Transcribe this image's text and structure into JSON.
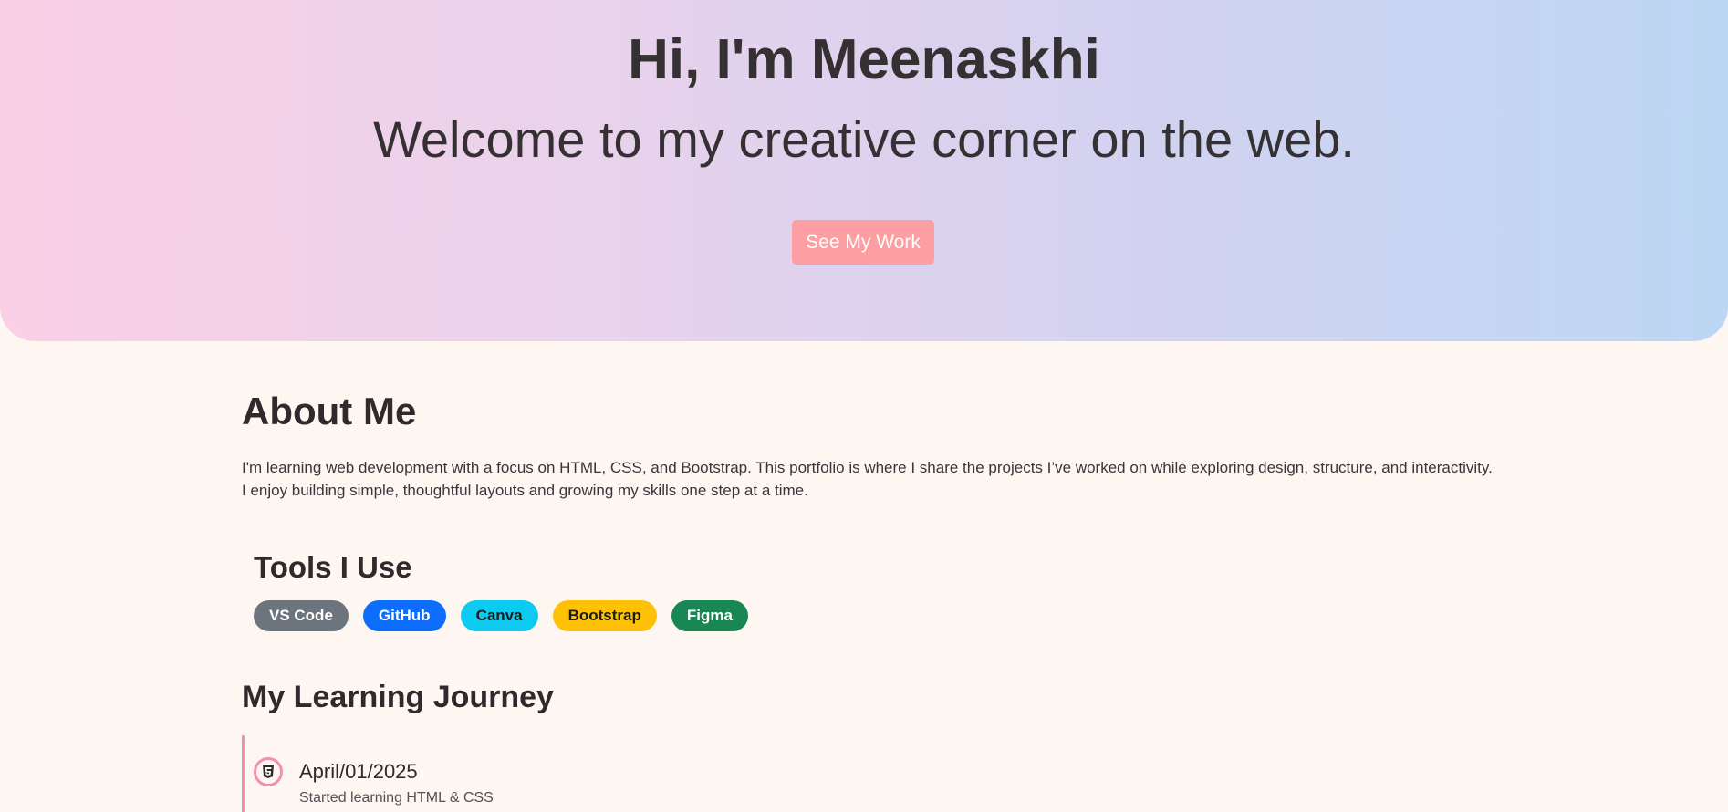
{
  "hero": {
    "title": "Hi, I'm Meenaskhi",
    "subtitle": "Welcome to my creative corner on the web.",
    "button_label": "See My Work"
  },
  "about": {
    "title": "About Me",
    "text": "I'm learning web development with a focus on HTML, CSS, and Bootstrap. This portfolio is where I share the projects I’ve worked on while exploring design, structure, and interactivity. I enjoy building simple, thoughtful layouts and growing my skills one step at a time."
  },
  "tools": {
    "title": "Tools I Use",
    "items": [
      {
        "label": "VS Code",
        "color": "#6c757d"
      },
      {
        "label": "GitHub",
        "color": "#0d6efd"
      },
      {
        "label": "Canva",
        "color": "#0dcaf0"
      },
      {
        "label": "Bootstrap",
        "color": "#ffc107"
      },
      {
        "label": "Figma",
        "color": "#198754"
      }
    ]
  },
  "journey": {
    "title": "My Learning Journey",
    "entries": [
      {
        "icon": "html5-icon",
        "date": "April/01/2025",
        "description": "Started learning HTML & CSS"
      }
    ]
  },
  "colors": {
    "accent": "#fd9ea3",
    "timeline": "#f48fb1",
    "page_background": "#fdf6f1"
  }
}
